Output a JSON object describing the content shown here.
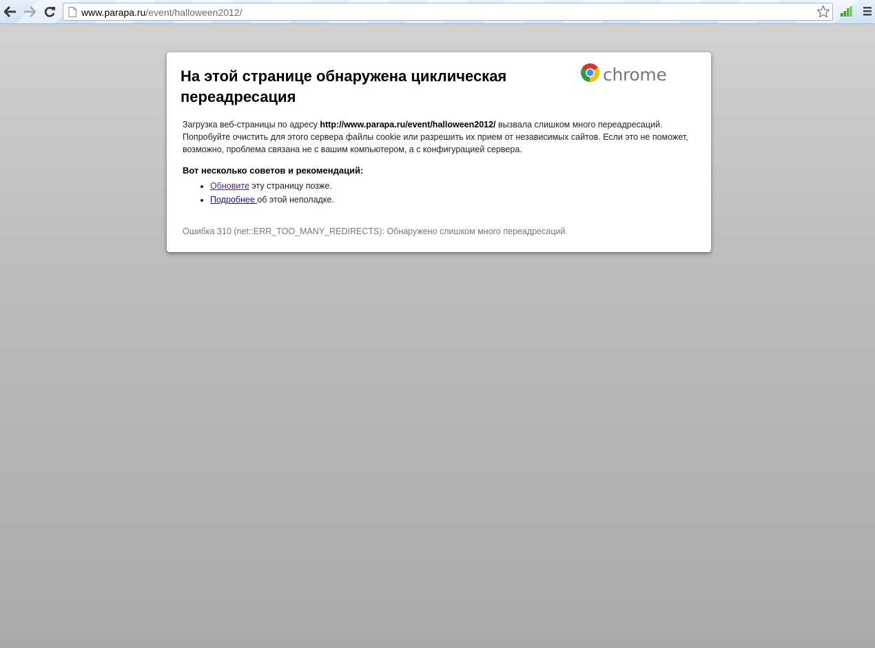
{
  "browser": {
    "url_host": "www.parapa.ru",
    "url_path": "/event/halloween2012/",
    "icons": {
      "back": "back-arrow-icon",
      "forward": "forward-arrow-icon",
      "reload": "reload-icon",
      "page": "page-icon",
      "bookmark": "star-icon",
      "extension": "signal-bars-icon",
      "menu": "menu-icon"
    }
  },
  "error_page": {
    "title": "На этой странице обнаружена циклическая переадресация",
    "brand": "chrome",
    "description_prefix": "Загрузка веб-страницы по адресу ",
    "description_url": "http://www.parapa.ru/event/halloween2012/",
    "description_suffix": " вызвала слишком много переадресаций. Попробуйте очистить для этого сервера файлы cookie или разрешить их прием от независимых сайтов. Если это не поможет, возможно, проблема связана не с вашим компьютером, а с конфигурацией сервера.",
    "tips_heading": "Вот несколько советов и рекомендаций:",
    "tips": [
      {
        "link": "Обновите",
        "text": " эту страницу позже."
      },
      {
        "link": "Подробнее ",
        "text": "об этой неполадке."
      }
    ],
    "error_code": "Ошибка 310 (net::ERR_TOO_MANY_REDIRECTS): Обнаружено слишком много переадресаций."
  },
  "colors": {
    "link_visited": "#551a8b",
    "link": "#1a0dab",
    "secondary_text": "#777777"
  }
}
